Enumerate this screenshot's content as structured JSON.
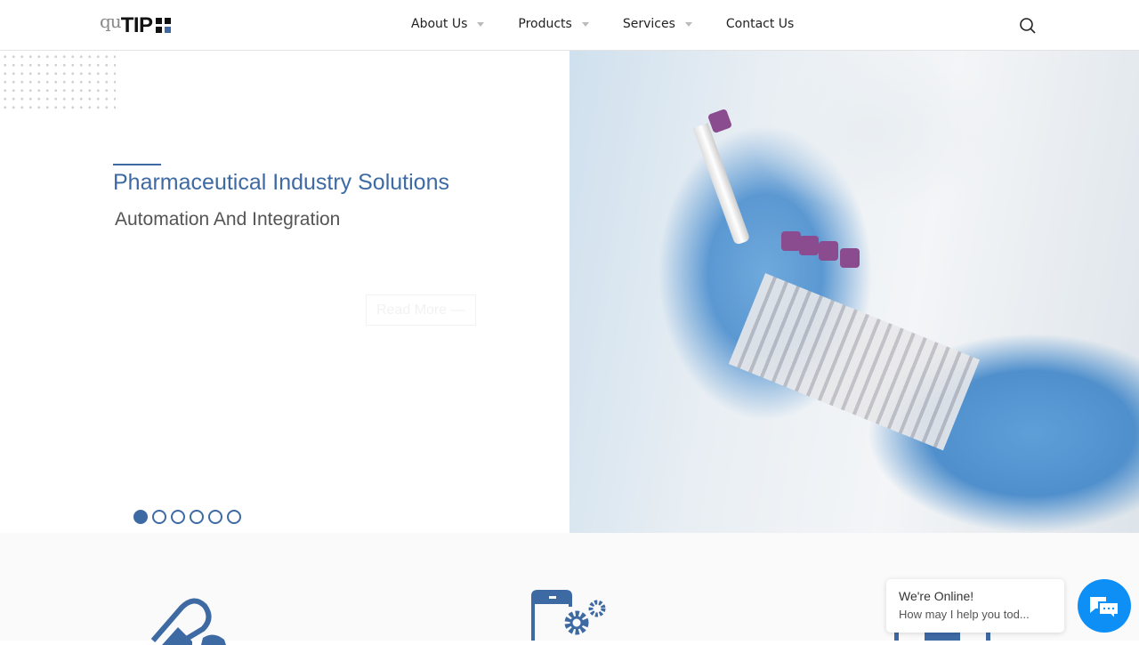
{
  "header": {
    "logo": {
      "prefix": "qu",
      "main": "TIP"
    },
    "nav": [
      {
        "label": "About Us",
        "has_dropdown": true
      },
      {
        "label": "Products",
        "has_dropdown": true
      },
      {
        "label": "Services",
        "has_dropdown": true
      },
      {
        "label": "Contact Us",
        "has_dropdown": false
      }
    ],
    "search_icon": "search-icon"
  },
  "hero": {
    "title": "Pharmaceutical Industry Solutions",
    "subtitle": "Automation And Integration",
    "read_more": "Read More —",
    "slides": 6,
    "active_slide": 1,
    "accent": "#3e6aa4"
  },
  "features": {
    "icons": [
      "pill-icon",
      "mobile-gear-icon",
      "robot-icon"
    ]
  },
  "chat": {
    "status": "We're Online!",
    "prompt": "How may I help you tod...",
    "color": "#0e8ff5"
  }
}
